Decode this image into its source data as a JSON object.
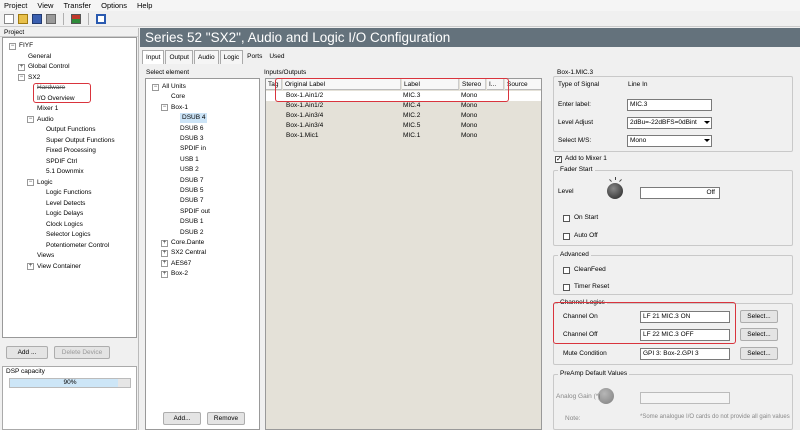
{
  "menu": [
    "Project",
    "View",
    "Transfer",
    "Options",
    "Help"
  ],
  "toolbar_icons": [
    "new-icon",
    "open-icon",
    "save-icon",
    "undo-icon",
    "flag-icon",
    "window-icon"
  ],
  "project": {
    "title": "Project",
    "tree": [
      {
        "label": "FIYF",
        "icon": "minus"
      },
      {
        "label": "General"
      },
      {
        "label": "Global Control",
        "icon": "plus"
      },
      {
        "label": "SX2",
        "icon": "minus"
      },
      {
        "label": "Hardware"
      },
      {
        "label": "I/O Overview"
      },
      {
        "label": "Mixer 1"
      },
      {
        "label": "Audio",
        "icon": "minus"
      },
      {
        "label": "Output Functions"
      },
      {
        "label": "Super Output Functions"
      },
      {
        "label": "Fixed Processing"
      },
      {
        "label": "SPDIF Ctrl"
      },
      {
        "label": "5.1 Downmix"
      },
      {
        "label": "Logic",
        "icon": "minus"
      },
      {
        "label": "Logic Functions"
      },
      {
        "label": "Level Detects"
      },
      {
        "label": "Logic Delays"
      },
      {
        "label": "Clock Logics"
      },
      {
        "label": "Selector Logics"
      },
      {
        "label": "Potentiometer Control"
      },
      {
        "label": "Views"
      },
      {
        "label": "View Container",
        "icon": "plus"
      }
    ],
    "add_button": "Add ...",
    "delete_button": "Delete Device",
    "dsp_label": "DSP capacity",
    "dsp_value": "90%",
    "dsp_fraction": 0.9
  },
  "title": "Series 52 \"SX2\", Audio and Logic I/O  Configuration",
  "tabs": [
    "Input",
    "Output",
    "Audio",
    "Logic",
    "Ports",
    "Used"
  ],
  "select_element": {
    "title": "Select element",
    "items": [
      {
        "label": "All Units",
        "icon": "minus"
      },
      {
        "label": "Core"
      },
      {
        "label": "Box-1",
        "icon": "minus"
      },
      {
        "label": "DSUB 4",
        "selected": true
      },
      {
        "label": "DSUB 6"
      },
      {
        "label": "DSUB 3"
      },
      {
        "label": "SPDIF in"
      },
      {
        "label": "USB 1"
      },
      {
        "label": "USB 2"
      },
      {
        "label": "DSUB 7"
      },
      {
        "label": "DSUB 5"
      },
      {
        "label": "DSUB 7"
      },
      {
        "label": "SPDIF out"
      },
      {
        "label": "DSUB 1"
      },
      {
        "label": "DSUB 2"
      },
      {
        "label": "Core.Dante",
        "icon": "plus"
      },
      {
        "label": "SX2 Central",
        "icon": "plus"
      },
      {
        "label": "AES67",
        "icon": "plus"
      },
      {
        "label": "Box-2",
        "icon": "plus"
      }
    ],
    "add_button": "Add...",
    "remove_button": "Remove"
  },
  "io": {
    "title": "Inputs/Outputs",
    "columns": [
      "Tag",
      "Original Label",
      "Label",
      "Stereo",
      "I...",
      "Source"
    ],
    "rows": [
      {
        "original": "Box-1.Ain1/2",
        "label": "MIC.3",
        "stereo": "Mono"
      },
      {
        "original": "Box-1.Ain1/2",
        "label": "MIC.4",
        "stereo": "Mono"
      },
      {
        "original": "Box-1.Ain3/4",
        "label": "MIC.2",
        "stereo": "Mono"
      },
      {
        "original": "Box-1.Ain3/4",
        "label": "MIC.5",
        "stereo": "Mono"
      },
      {
        "original": "Box-1.Mic1",
        "label": "MIC.1",
        "stereo": "Mono"
      }
    ]
  },
  "props": {
    "header": "Box-1.MIC.3",
    "type_label": "Type of Signal",
    "type_value": "Line In",
    "enter_label": "Enter label:",
    "enter_value": "MIC.3",
    "level_label": "Level Adjust",
    "level_value": "2dBu=-22dBFS=0dBint",
    "select_ms_label": "Select M/S:",
    "select_ms_value": "Mono",
    "add_mixer": "Add to Mixer 1",
    "fader_start": "Fader Start",
    "level": "Level",
    "level_state": "Off",
    "on_start": "On Start",
    "auto_off": "Auto Off",
    "advanced": "Advanced",
    "cleanfeed": "CleanFeed",
    "timer_reset": "Timer Reset",
    "channel_logics": "Channel Logics",
    "channel_on_label": "Channel On",
    "channel_on_value": "LF 21 MIC.3 ON",
    "channel_off_label": "Channel Off",
    "channel_off_value": "LF 22 MIC.3 OFF",
    "mute_label": "Mute Condition",
    "mute_value": "GPI 3: Box-2.GPI 3",
    "select_button": "Select...",
    "preamp": "PreAmp Default Values",
    "analog_gain": "Analog Gain (*)",
    "note_label": "Note:",
    "note_text": "*Some analogue I/O cards do not provide all gain values"
  }
}
